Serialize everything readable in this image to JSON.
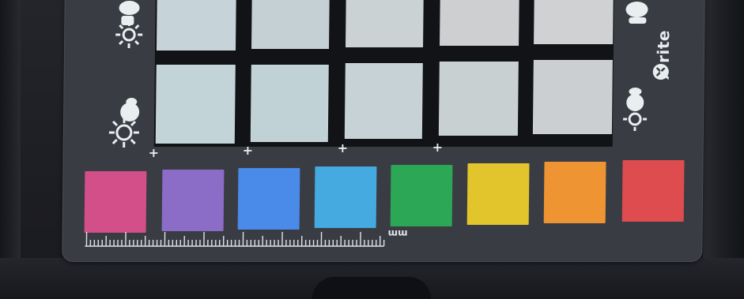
{
  "brand": {
    "logo_text": "x·rite"
  },
  "ruler": {
    "unit_label": "mm"
  },
  "top_row_patches": [
    "#c6d3d8",
    "#c4d0d4",
    "#cbd2d4",
    "#cdcfd0",
    "#d0d1d3"
  ],
  "mid_row_patches": [
    "#c2d4d8",
    "#c1d2d6",
    "#c6d2d5",
    "#c8d0d2",
    "#cbcfd1"
  ],
  "color_patches": [
    {
      "name": "magenta",
      "color": "#d24f89"
    },
    {
      "name": "violet",
      "color": "#8b6dc8"
    },
    {
      "name": "blue",
      "color": "#4a8ae8"
    },
    {
      "name": "cyan",
      "color": "#44aadf"
    },
    {
      "name": "green",
      "color": "#2ca756"
    },
    {
      "name": "yellow",
      "color": "#e2c52c"
    },
    {
      "name": "orange",
      "color": "#ef9433"
    },
    {
      "name": "red",
      "color": "#de4c4f"
    }
  ],
  "icons": [
    "sun-icon",
    "subject-icon",
    "plus-icon",
    "ruler-icon",
    "xrite-logo-icon"
  ]
}
